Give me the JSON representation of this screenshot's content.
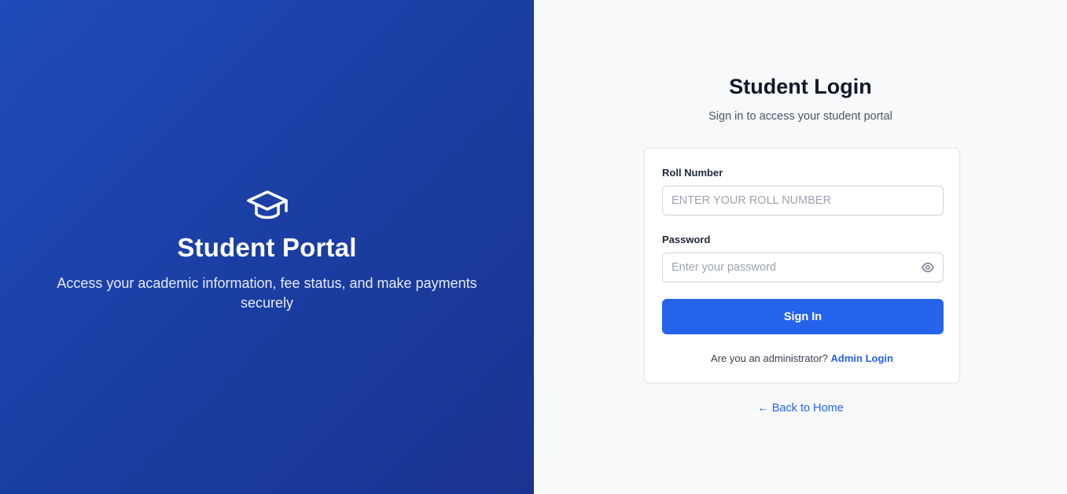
{
  "hero": {
    "icon": "graduation-cap-icon",
    "title": "Student Portal",
    "subtitle": "Access your academic information, fee status, and make payments securely"
  },
  "login": {
    "title": "Student Login",
    "subtitle": "Sign in to access your student portal",
    "roll_label": "Roll Number",
    "roll_placeholder": "ENTER YOUR ROLL NUMBER",
    "roll_value": "",
    "password_label": "Password",
    "password_placeholder": "Enter your password",
    "password_value": "",
    "password_toggle_icon": "eye-icon",
    "signin_label": "Sign In",
    "admin_prompt": "Are you an administrator?",
    "admin_link": "Admin Login",
    "back_home": "← Back to Home"
  },
  "colors": {
    "hero_gradient_start": "#1e4bb8",
    "hero_gradient_end": "#1a338f",
    "accent": "#2563eb",
    "right_bg": "#f8f9fb"
  }
}
